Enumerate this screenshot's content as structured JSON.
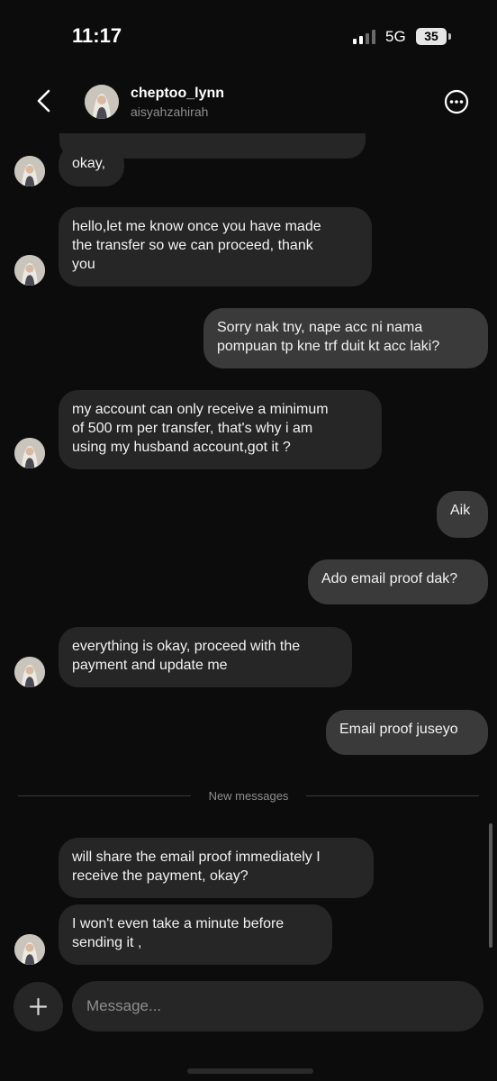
{
  "status": {
    "time": "11:17",
    "network": "5G",
    "battery": "35"
  },
  "header": {
    "name": "cheptoo_lynn",
    "username": "aisyahzahirah"
  },
  "messages": [
    {
      "from": "them",
      "text": "okay,"
    },
    {
      "from": "them",
      "text": "hello,let me know once you have made\nthe transfer so we can proceed, thank\nyou"
    },
    {
      "from": "me",
      "text": "Sorry nak tny, nape acc ni nama\npompuan tp kne trf duit kt acc laki?"
    },
    {
      "from": "them",
      "text": "my account can only receive a minimum\nof 500 rm per transfer, that's why i am\nusing my husband account,got it ?"
    },
    {
      "from": "me",
      "text": "Aik"
    },
    {
      "from": "me",
      "text": "Ado email proof dak?"
    },
    {
      "from": "them",
      "text": "everything is okay, proceed with the\npayment and update me"
    },
    {
      "from": "me",
      "text": "Email proof juseyo"
    },
    {
      "from": "them",
      "text": "will share the email proof immediately I\nreceive the payment, okay?"
    },
    {
      "from": "them",
      "text": "I won't even take a minute before\nsending it ,"
    }
  ],
  "divider": {
    "label": "New messages"
  },
  "composer": {
    "placeholder": "Message..."
  },
  "colors": {
    "background": "#0c0c0c",
    "incoming_bubble": "#262626",
    "outgoing_bubble": "#3a3a3a"
  }
}
